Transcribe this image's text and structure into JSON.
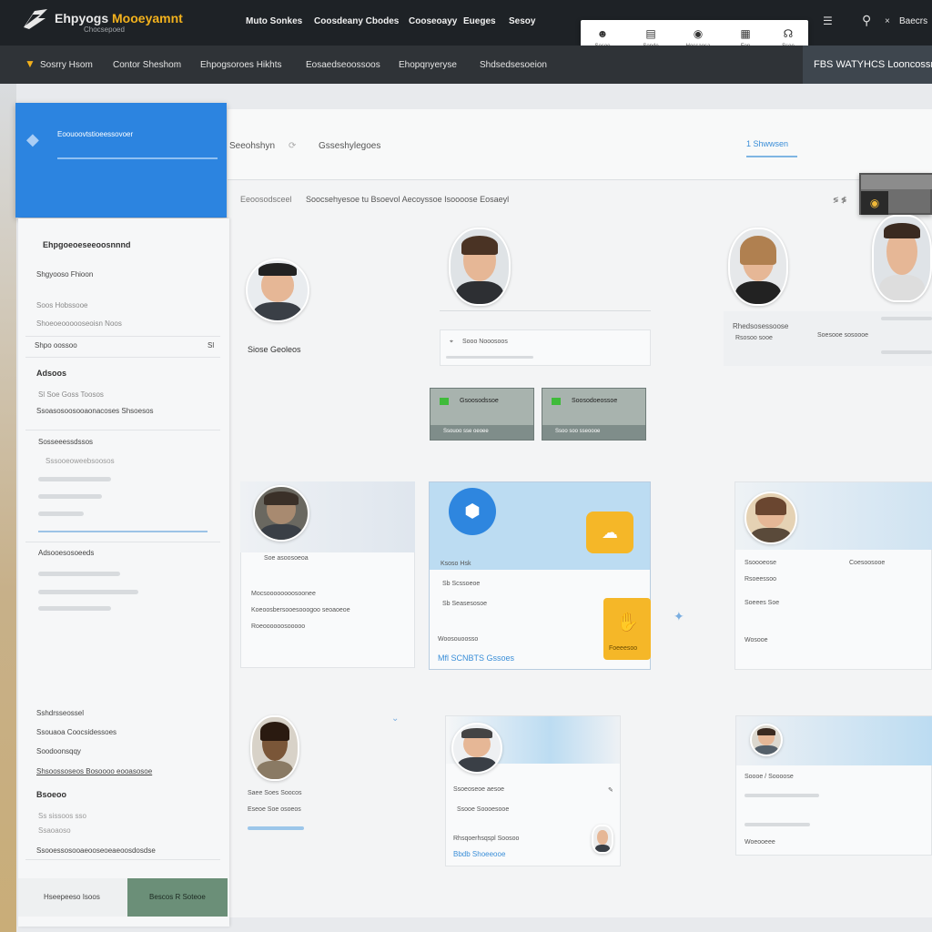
{
  "app": {
    "name_a": "Ehpyogs",
    "name_b": "Mooeyamnt",
    "subtitle": "Chocsepoed"
  },
  "nav": {
    "items": [
      "Muto Sonkes",
      "Coosdeany Cbodes",
      "Cooseoayy",
      "Eueges",
      "Sesoy"
    ]
  },
  "top_icons": [
    {
      "icon": "person-icon",
      "label": "Sesoe",
      "glyph": "☻"
    },
    {
      "icon": "document-icon",
      "label": "Sonde",
      "glyph": "▤"
    },
    {
      "icon": "user-circle-icon",
      "label": "Hossaosa",
      "glyph": "◉"
    },
    {
      "icon": "building-icon",
      "label": "Fop",
      "glyph": "▦"
    },
    {
      "icon": "headset-icon",
      "label": "Ssoe",
      "glyph": "☊"
    }
  ],
  "header_right": {
    "menu_glyph": "☰",
    "user_glyph": "⚲",
    "separator": "×",
    "user_name": "Baecrs"
  },
  "subnav": {
    "items": [
      "Sosrry Hsom",
      "Contor Sheshom",
      "Ehpogsoroes Hikhts",
      "Eosaedseoossoos",
      "Ehopqnyeryse",
      "Shdsedsesoeion"
    ],
    "right_text": "FBS WATYHCS Looncossn"
  },
  "blue_card": {
    "title": "Eoouoovtstioeessovoer"
  },
  "tabs": {
    "tab1": "Seeohshyn",
    "arrow": "⟳",
    "tab2": "Gsseshylegoes",
    "active": "1 Shwwsen"
  },
  "breadcrumb": {
    "left": "Eeoosodsceel",
    "right": "Soocsehyesoe tu Bsoevol Aecoyssoe Isoooose Eosaeyl",
    "zoom": "≶ ≸"
  },
  "sidebar": {
    "title": "Ehpgoeoeseeoosnnnd",
    "item1": "Shgyooso Fhioon",
    "item2": "Soos Hobssooe",
    "item3": "Shoeoeoooooseoisn Noos",
    "row_label": "Shpo oossoo",
    "row_value": "Sl",
    "section1": "Adsoos",
    "s1a": "Sl Soe Goss Toosos",
    "s1b": "Ssoasosoosooaonacoses Shsoesos",
    "section2": "Sosseeessdssos",
    "s2a": "Sssooeoweebsoosos",
    "section3": "Adsooesosoeeds",
    "footer1": "Sshdrsseossel",
    "footer2": "Ssouaoa Coocsidessoes",
    "footer3": "Soodoonsqqy",
    "footer4": "Shsoossoseos Bosoooo eooasosoe",
    "section4": "Bsoeoo",
    "s4a": "Ss sissoos sso",
    "s4b": "Ssaoaoso",
    "footer5": "Ssooessosooaeooseoeaeoosdosdse",
    "btn1": "Hseepeeso Isoos",
    "btn2": "Bescos R Soteoe"
  },
  "profiles": {
    "p1_name": "Siose Geoleos",
    "p2_info": "Sooo Nooosoos",
    "p3_name": "Rhedsosessoose",
    "p3_sub": "Rsosoo sooe",
    "p3_right": "Soesooe sosoooe",
    "btn_a": "Gsoosodssoe",
    "btn_a_sub": "Ssouoo sse oeoee",
    "btn_b": "Soosodoeossoe",
    "btn_b_sub": "Ssoo soo sseoooe"
  },
  "cards": {
    "c1_title": "Soe asoosoeoa",
    "c1_l1": "Mocsoooooooosoonee",
    "c1_l2": "Koeoosbersooesooogoo seoaoeoe",
    "c1_l3": "Roeoooooosooooo",
    "c2_title": "Ksoso Hsk",
    "c2_l1": "Sb Scssoeoe",
    "c2_l2": "Sb Seasesosoe",
    "c2_l3": "Woosouoosso",
    "c2_link": "Mfl SCNBTS Gssoes",
    "c2_badge": "Foeeesoo",
    "c3_name": "Ssoooeose",
    "c3_right": "Coesoosooe",
    "c3_l1": "Rsoeessoo",
    "c3_l2": "Soeees Soe",
    "c3_l3": "Wosooe",
    "p4_name": "Saee Soes Soocos",
    "p4_l2": "Eseoe Soe osoeos",
    "c4_title": "Ssoeoseoe aesoe",
    "c4_l1": "Ssooe Soooesooe",
    "c4_l2": "Rhsqoerhsqspl Soosoo",
    "c4_link": "Bbdb Shoeeooe",
    "c5_title": "Soooe / Soooose",
    "c5_l2": "Woeooeee"
  },
  "colors": {
    "accent_blue": "#2c84e0",
    "gold": "#f5b728",
    "green": "#3fbb3a",
    "dark_bar": "#1e2226"
  }
}
